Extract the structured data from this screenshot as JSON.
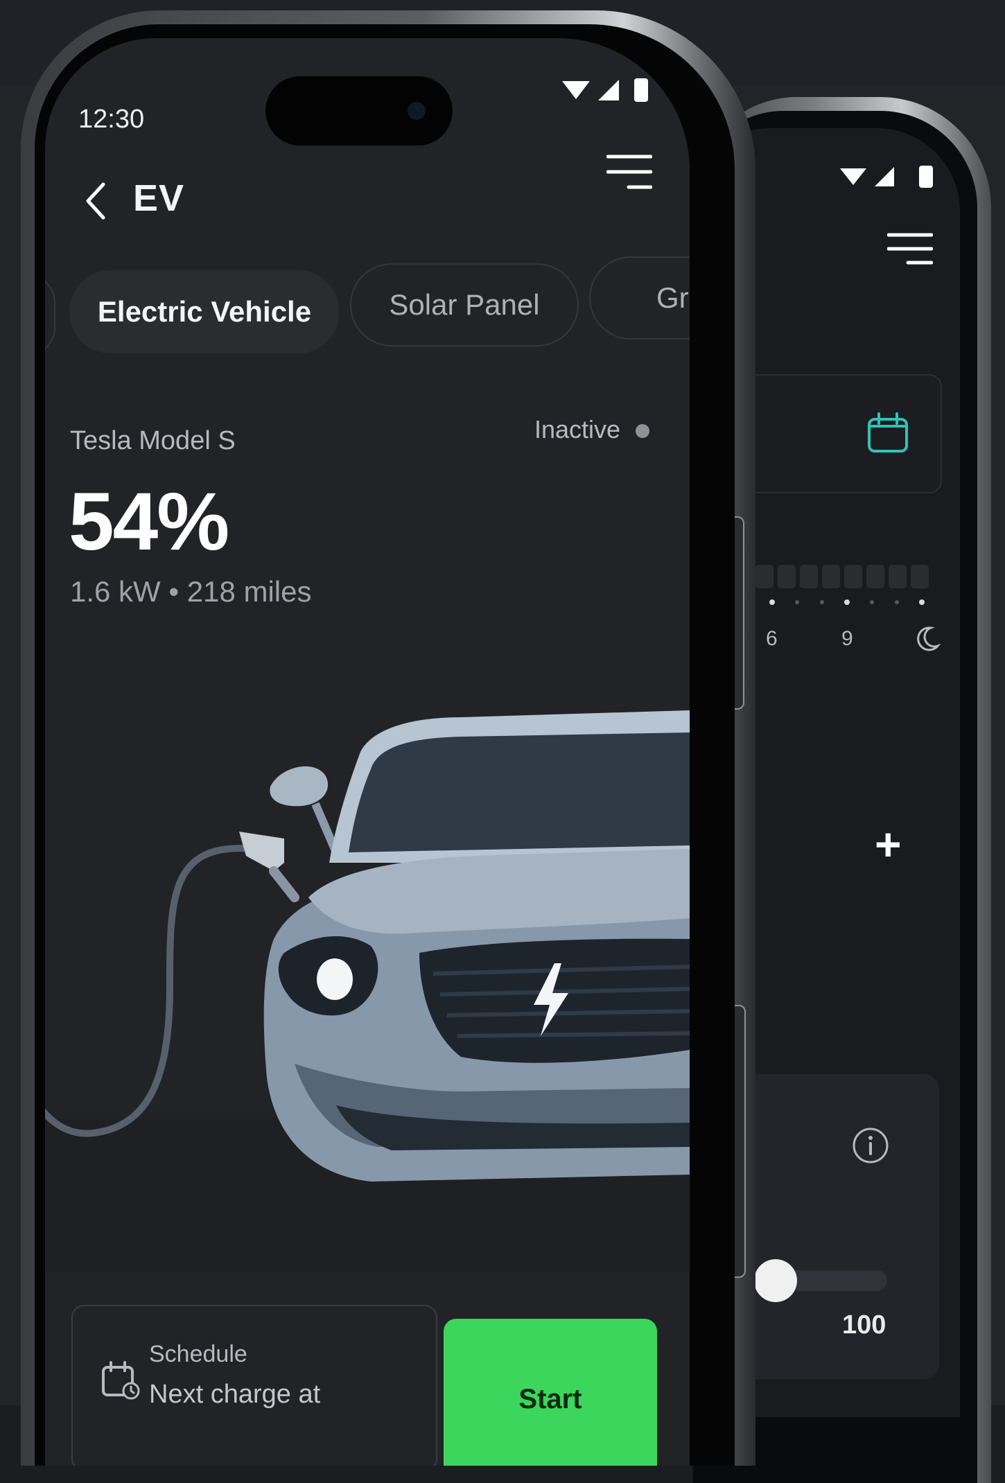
{
  "status_bar": {
    "time": "12:30"
  },
  "header": {
    "title": "EV"
  },
  "tabs": [
    {
      "label": ""
    },
    {
      "label": "Electric Vehicle"
    },
    {
      "label": "Solar Panel"
    },
    {
      "label": "Gri"
    }
  ],
  "vehicle": {
    "model": "Tesla Model S",
    "status": "Inactive",
    "battery_percent": "54%",
    "details": "1.6 kW • 218 miles"
  },
  "schedule": {
    "label": "Schedule",
    "text": "Next charge at"
  },
  "actions": {
    "start_label": "Start"
  },
  "back_screen": {
    "time_axis": [
      "6",
      "9"
    ],
    "plus_label": "+",
    "slider_value": "100"
  },
  "colors": {
    "accent_green": "#3bd65b",
    "accent_teal": "#2ec4b6",
    "background": "#222326"
  }
}
